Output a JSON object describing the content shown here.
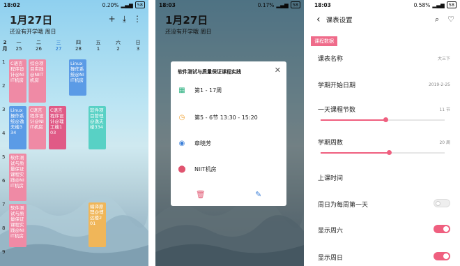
{
  "panel1": {
    "status": {
      "time": "18:02",
      "speed": "0.20%",
      "battery": "58"
    },
    "date_title": "1月27日",
    "subtitle": "还没有开学哦  周日",
    "month": "2\n月",
    "weekdays": [
      {
        "name": "一",
        "date": "25"
      },
      {
        "name": "二",
        "date": "26"
      },
      {
        "name": "三",
        "date": "27"
      },
      {
        "name": "四",
        "date": "28"
      },
      {
        "name": "五",
        "date": "1"
      },
      {
        "name": "六",
        "date": "2"
      },
      {
        "name": "日",
        "date": "3"
      }
    ],
    "periods": [
      "1",
      "2",
      "3",
      "4",
      "5",
      "6",
      "7",
      "8",
      "9"
    ],
    "courses": [
      {
        "text": "C语言程序设计@NIIT机房",
        "color": "#ef8aa5"
      },
      {
        "text": "综合项目实践@NIIT机房",
        "color": "#ef8aa5"
      },
      {
        "text": "Linux操作系统@NIIT机房",
        "color": "#5b9be6"
      },
      {
        "text": "Linux操作系统@逸夫楼334",
        "color": "#5b9be6"
      },
      {
        "text": "C语言程序设计@NIIT机房",
        "color": "#ef8aa5"
      },
      {
        "text": "C语言程序设计@理工楼103",
        "color": "#e05a86"
      },
      {
        "text": "软件项目管理@逸夫楼334",
        "color": "#58d1c5"
      },
      {
        "text": "软件测试与质量保证课程实践@NIIT机房",
        "color": "#ef8aa5"
      },
      {
        "text": "软件测试与质量保证课程实践@NIIT机房",
        "color": "#ef8aa5"
      },
      {
        "text": "编译原理@博远楼201",
        "color": "#f0b659"
      }
    ]
  },
  "panel2": {
    "status": {
      "time": "18:03",
      "speed": "0.17%",
      "battery": "58"
    },
    "dialog": {
      "title": "软件测试与质量保证课程实践",
      "weeks": "第1 - 17周",
      "time": "第5 - 6节    13:30 - 15:20",
      "teacher": "章晓芳",
      "location": "NIIT机房"
    }
  },
  "panel3": {
    "status": {
      "time": "18:03",
      "speed": "0.58%",
      "battery": "58"
    },
    "title": "课表设置",
    "section": "课程数据",
    "rows": {
      "name_label": "课表名称",
      "name_value": "大三下",
      "start_label": "学期开始日期",
      "start_value": "2019-2-25",
      "periods_label": "一天课程节数",
      "periods_value": "11 节",
      "periods_fraction": 0.52,
      "weeks_label": "学期周数",
      "weeks_value": "20 周",
      "weeks_fraction": 0.55,
      "time_label": "上课时间",
      "sunday_first_label": "周日为每周第一天",
      "show_sat_label": "显示周六",
      "show_sun_label": "显示周日"
    },
    "colors": {
      "accent": "#ef5f7f"
    }
  }
}
